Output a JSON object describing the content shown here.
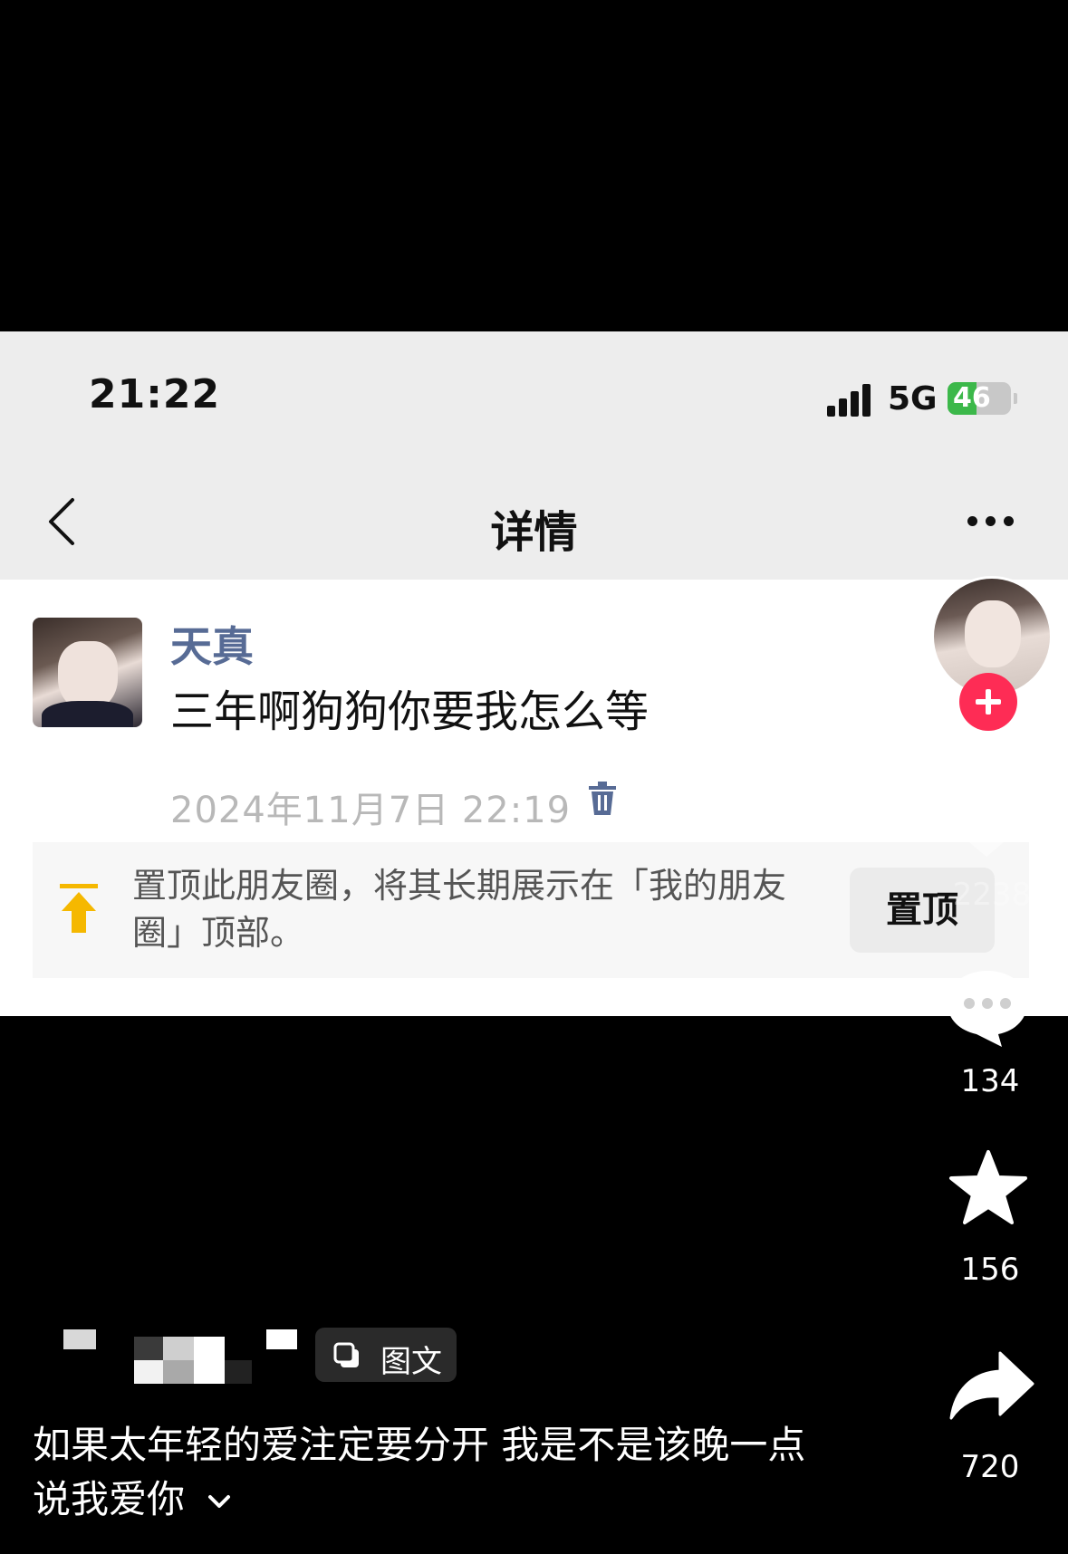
{
  "screenshot": {
    "status_bar": {
      "time": "21:22",
      "network": "5G",
      "battery": "46",
      "battery_level": 0.46
    },
    "navbar": {
      "title": "详情"
    },
    "post": {
      "username": "天真",
      "content": "三年啊狗狗你要我怎么等",
      "timestamp": "2024年11月7日 22:19"
    },
    "pin_banner": {
      "text": "置顶此朋友圈，将其长期展示在「我的朋友圈」顶部。",
      "button_label": "置顶"
    }
  },
  "actions": {
    "like_count": "2238",
    "comment_count": "134",
    "favorite_count": "156",
    "share_count": "720"
  },
  "video_info": {
    "tag_label": "图文",
    "caption": "如果太年轻的爱注定要分开 我是不是该晚一点说我爱你"
  },
  "colors": {
    "accent_username": "#576b95",
    "follow_button": "#fe2c55",
    "battery_green": "#3cb84a",
    "pin_arrow": "#f5b800"
  },
  "icons": [
    "back-icon",
    "more-icon",
    "trash-icon",
    "pin-top-icon",
    "plus-icon",
    "heart-icon",
    "comment-icon",
    "star-icon",
    "share-icon",
    "image-text-icon",
    "chevron-down-icon"
  ]
}
